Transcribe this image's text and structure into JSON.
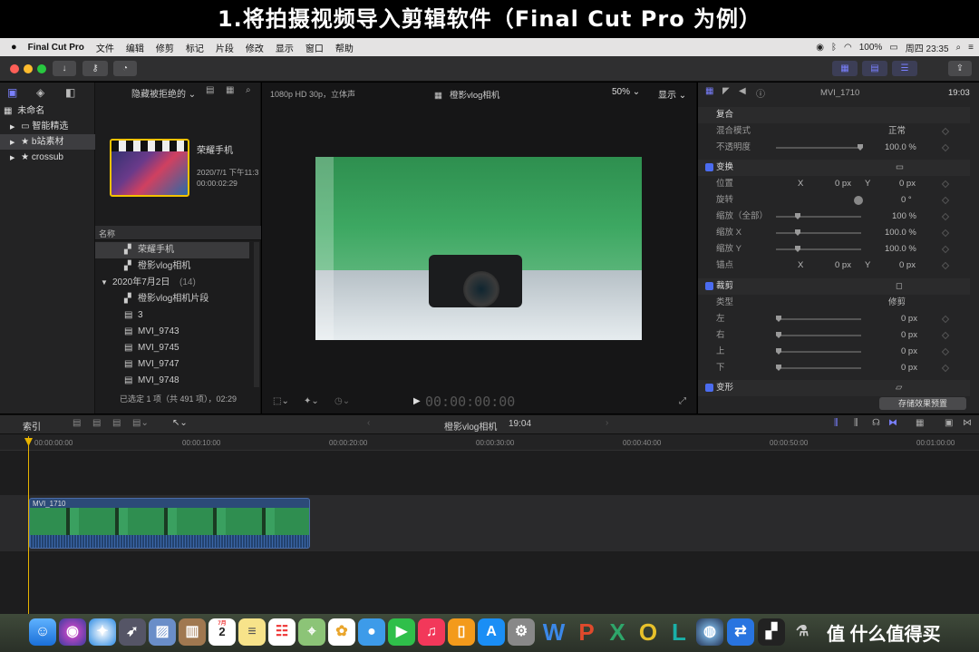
{
  "banner": {
    "title": "1.将拍摄视频导入剪辑软件（Final Cut Pro 为例）"
  },
  "menubar": {
    "app": "Final Cut Pro",
    "items": [
      "文件",
      "编辑",
      "修剪",
      "标记",
      "片段",
      "修改",
      "显示",
      "窗口",
      "帮助"
    ],
    "battery": "100%",
    "clock": "周四 23:35"
  },
  "sidebar": {
    "library": "未命名",
    "items": [
      {
        "label": "智能精选"
      },
      {
        "label": "b站素材"
      },
      {
        "label": "crossub"
      }
    ]
  },
  "browser": {
    "filter": "隐藏被拒绝的",
    "clip": {
      "name": "荣耀手机",
      "date": "2020/7/1 下午11:3",
      "duration": "00:00:02:29"
    },
    "list_header": "名称",
    "list": [
      {
        "label": "荣耀手机"
      },
      {
        "label": "橙影vlog相机"
      },
      {
        "label": "2020年7月2日",
        "count": "(14)"
      },
      {
        "label": "橙影vlog相机片段"
      },
      {
        "label": "3"
      },
      {
        "label": "MVI_9743"
      },
      {
        "label": "MVI_9745"
      },
      {
        "label": "MVI_9747"
      },
      {
        "label": "MVI_9748"
      }
    ],
    "status": "已选定 1 项（共 491 项），02:29"
  },
  "viewer": {
    "format": "1080p HD 30p，立体声",
    "project": "橙影vlog相机",
    "zoom": "50%",
    "display": "显示",
    "timecode": "00:00:00:00"
  },
  "inspector": {
    "clip": "MVI_1710",
    "time": "19:03",
    "composite": "复合",
    "blend_label": "混合模式",
    "blend_value": "正常",
    "opacity_label": "不透明度",
    "opacity_value": "100.0 %",
    "transform": "变换",
    "position": "位置",
    "rotation": "旋转",
    "scale_all": "缩放（全部）",
    "scale_x": "缩放 X",
    "scale_y": "缩放 Y",
    "anchor": "锚点",
    "x": "X",
    "y": "Y",
    "px0": "0 px",
    "deg0": "0 °",
    "pct100": "100 %",
    "pct1000": "100.0 %",
    "crop": "裁剪",
    "type": "类型",
    "type_value": "修剪",
    "left": "左",
    "right": "右",
    "top": "上",
    "bottom": "下",
    "distort": "变形",
    "save_preset": "存储效果预置"
  },
  "timeline": {
    "index": "索引",
    "project": "橙影vlog相机",
    "duration": "19:04",
    "ticks": [
      "00:00:00:00",
      "00:00:10:00",
      "00:00:20:00",
      "00:00:30:00",
      "00:00:40:00",
      "00:00:50:00",
      "00:01:00:00"
    ],
    "clip_name": "MVI_1710"
  },
  "dock": {
    "calendar_month": "7月",
    "calendar_day": "2",
    "watermark": "值 什么值得买"
  }
}
